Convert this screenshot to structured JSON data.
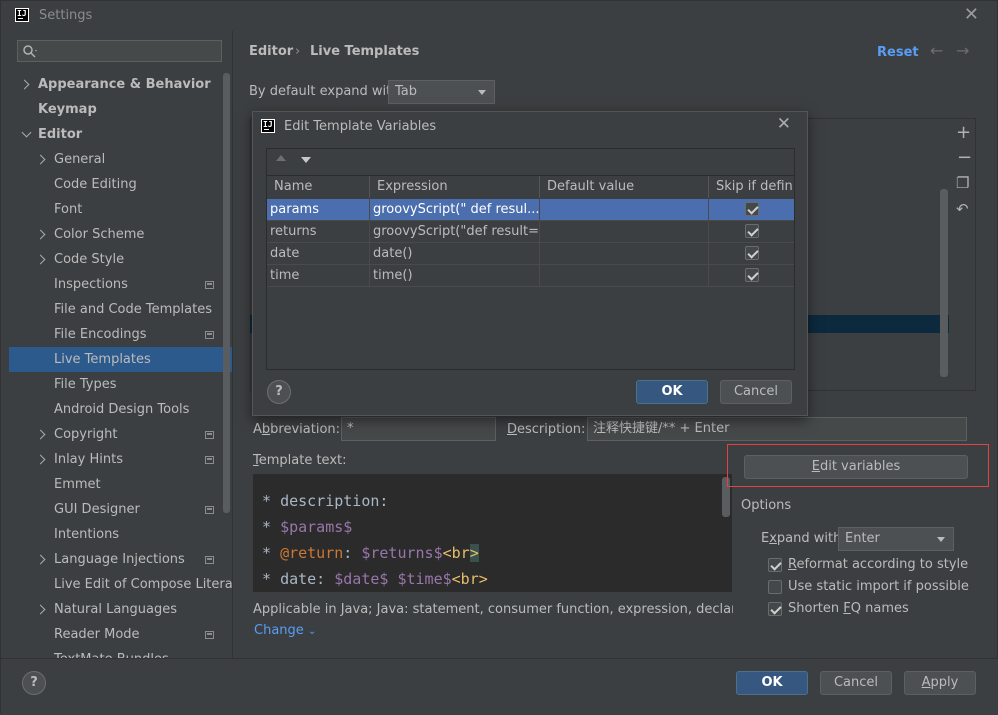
{
  "window": {
    "title": "Settings"
  },
  "search": {
    "placeholder": ""
  },
  "sidebar": {
    "items": [
      {
        "label": "Appearance & Behavior"
      },
      {
        "label": "Keymap"
      },
      {
        "label": "Editor"
      },
      {
        "label": "General"
      },
      {
        "label": "Code Editing"
      },
      {
        "label": "Font"
      },
      {
        "label": "Color Scheme"
      },
      {
        "label": "Code Style"
      },
      {
        "label": "Inspections"
      },
      {
        "label": "File and Code Templates"
      },
      {
        "label": "File Encodings"
      },
      {
        "label": "Live Templates"
      },
      {
        "label": "File Types"
      },
      {
        "label": "Android Design Tools"
      },
      {
        "label": "Copyright"
      },
      {
        "label": "Inlay Hints"
      },
      {
        "label": "Emmet"
      },
      {
        "label": "GUI Designer"
      },
      {
        "label": "Intentions"
      },
      {
        "label": "Language Injections"
      },
      {
        "label": "Live Edit of Compose Litera"
      },
      {
        "label": "Natural Languages"
      },
      {
        "label": "Reader Mode"
      },
      {
        "label": "TextMate Bundles"
      }
    ]
  },
  "header": {
    "breadcrumb": [
      "Editor",
      "Live Templates"
    ],
    "separator": "›",
    "reset": "Reset"
  },
  "expand_default": {
    "label": "By default expand with",
    "value": "Tab"
  },
  "dialog": {
    "title": "Edit Template Variables",
    "columns": [
      "Name",
      "Expression",
      "Default value",
      "Skip if defin..."
    ],
    "rows": [
      {
        "name": "params",
        "expression": "groovyScript(\"      def resul...",
        "default": "",
        "skip": true
      },
      {
        "name": "returns",
        "expression": "groovyScript(\"def result=\"...",
        "default": "",
        "skip": true
      },
      {
        "name": "date",
        "expression": "date()",
        "default": "",
        "skip": true
      },
      {
        "name": "time",
        "expression": "time()",
        "default": "",
        "skip": true
      }
    ],
    "help": "?",
    "ok": "OK",
    "cancel": "Cancel"
  },
  "abbreviation": {
    "label_pre": "A",
    "label_u": "b",
    "label_post": "breviation:",
    "value": "*"
  },
  "description": {
    "label_u": "D",
    "label_post": "escription:",
    "value": "注释快捷键/** + Enter"
  },
  "template_text": {
    "label_u": "T",
    "label_post": "emplate text:"
  },
  "code": [
    {
      "star": "* ",
      "text": "description:"
    },
    {
      "star": "* ",
      "var": "$params$"
    },
    {
      "star": "* ",
      "kw": "@return",
      "mid": ": ",
      "var": "$returns$",
      "tag": "<br",
      "tagb": ">"
    },
    {
      "star": "* ",
      "text": "date: ",
      "var": "$date$",
      "space": " ",
      "var2": "$time$",
      "tag": "<br>"
    }
  ],
  "edit_variables": {
    "label_u": "E",
    "label_post": "dit variables"
  },
  "options": {
    "title": "Options",
    "expand_with": {
      "label_pre": "E",
      "label_u": "x",
      "label_post": "pand with",
      "value": "Enter"
    },
    "reformat": {
      "label_u": "R",
      "label_post": "eformat according to style",
      "checked": true
    },
    "static_import": {
      "label": "Use static import if possible",
      "checked": false
    },
    "shorten_fq": {
      "label_pre": "Shorten ",
      "label_u": "F",
      "label_post": "Q names",
      "checked": true
    }
  },
  "applicable": {
    "text": "Applicable in Java; Java: statement, consumer function, expression, declaration, c...",
    "change": "Change"
  },
  "footer": {
    "help": "?",
    "ok": "OK",
    "cancel": "Cancel",
    "apply_u": "A",
    "apply_post": "pply"
  },
  "colors": {
    "accent": "#589df6",
    "selection": "#4b6eaf",
    "highlight": "#e04343"
  }
}
